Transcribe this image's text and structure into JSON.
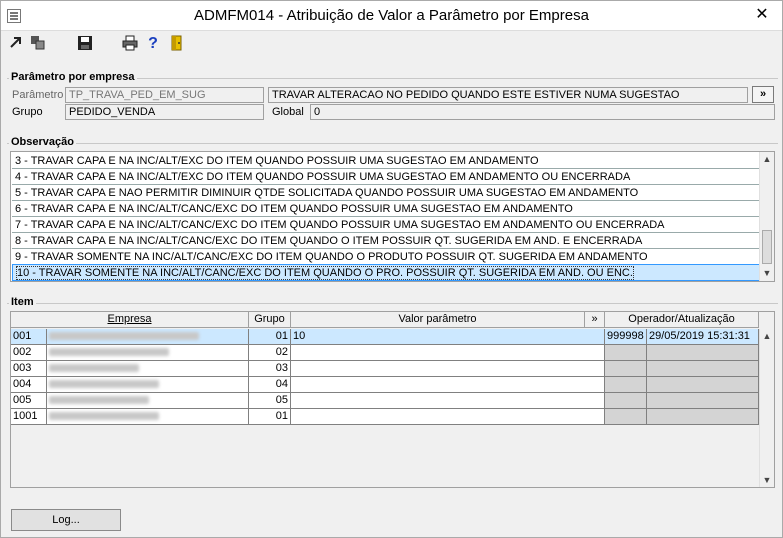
{
  "window": {
    "title": "ADMFM014 - Atribuição de Valor a Parâmetro por Empresa",
    "close_glyph": "✕"
  },
  "toolbar": {
    "icons": [
      "exit-icon",
      "copy-icon",
      "save-icon",
      "print-icon",
      "help-icon",
      "door-icon"
    ]
  },
  "parametro": {
    "group_label": "Parâmetro por empresa",
    "parametro_label": "Parâmetro",
    "parametro_value": "TP_TRAVA_PED_EM_SUG",
    "descricao_value": "TRAVAR ALTERACAO NO PEDIDO QUANDO ESTE ESTIVER NUMA SUGESTAO",
    "expand_label": "»",
    "grupo_label": "Grupo",
    "grupo_value": "PEDIDO_VENDA",
    "global_label": "Global",
    "global_value": "0"
  },
  "observacao": {
    "group_label": "Observação",
    "lines": [
      "3 - TRAVAR CAPA E NA INC/ALT/EXC DO ITEM QUANDO POSSUIR UMA SUGESTAO EM ANDAMENTO",
      "4 - TRAVAR CAPA E NA INC/ALT/EXC DO ITEM QUANDO POSSUIR UMA SUGESTAO EM ANDAMENTO OU ENCERRADA",
      "5 - TRAVAR CAPA E NAO PERMITIR DIMINUIR QTDE SOLICITADA QUANDO POSSUIR UMA SUGESTAO EM ANDAMENTO",
      "6 - TRAVAR CAPA E NA INC/ALT/CANC/EXC DO ITEM QUANDO POSSUIR UMA SUGESTAO EM ANDAMENTO",
      "7 - TRAVAR CAPA E NA INC/ALT/CANC/EXC DO ITEM QUANDO POSSUIR UMA SUGESTAO EM ANDAMENTO OU ENCERRADA",
      "8 - TRAVAR CAPA E NA INC/ALT/CANC/EXC DO ITEM QUANDO O ITEM POSSUIR QT. SUGERIDA EM AND. E ENCERRADA",
      "9 - TRAVAR SOMENTE NA INC/ALT/CANC/EXC DO ITEM QUANDO O PRODUTO POSSUIR QT. SUGERIDA EM ANDAMENTO",
      "10 - TRAVAR SOMENTE NA INC/ALT/CANC/EXC DO ITEM QUANDO O PRO. POSSUIR QT. SUGERIDA EM AND. OU ENC."
    ],
    "selected_index": 7
  },
  "item": {
    "group_label": "Item",
    "headers": {
      "empresa": "Empresa",
      "grupo": "Grupo",
      "valor": "Valor parâmetro",
      "expand": "»",
      "operador": "Operador/Atualização"
    },
    "rows": [
      {
        "codigo": "001",
        "grupo": "01",
        "valor": "10",
        "operador": "999998",
        "atualizacao": "29/05/2019 15:31:31",
        "selected": true
      },
      {
        "codigo": "002",
        "grupo": "02",
        "valor": "",
        "operador": "",
        "atualizacao": "",
        "selected": false
      },
      {
        "codigo": "003",
        "grupo": "03",
        "valor": "",
        "operador": "",
        "atualizacao": "",
        "selected": false
      },
      {
        "codigo": "004",
        "grupo": "04",
        "valor": "",
        "operador": "",
        "atualizacao": "",
        "selected": false
      },
      {
        "codigo": "005",
        "grupo": "05",
        "valor": "",
        "operador": "",
        "atualizacao": "",
        "selected": false
      },
      {
        "codigo": "1001",
        "grupo": "01",
        "valor": "",
        "operador": "",
        "atualizacao": "",
        "selected": false
      }
    ]
  },
  "footer": {
    "log_button": "Log..."
  }
}
